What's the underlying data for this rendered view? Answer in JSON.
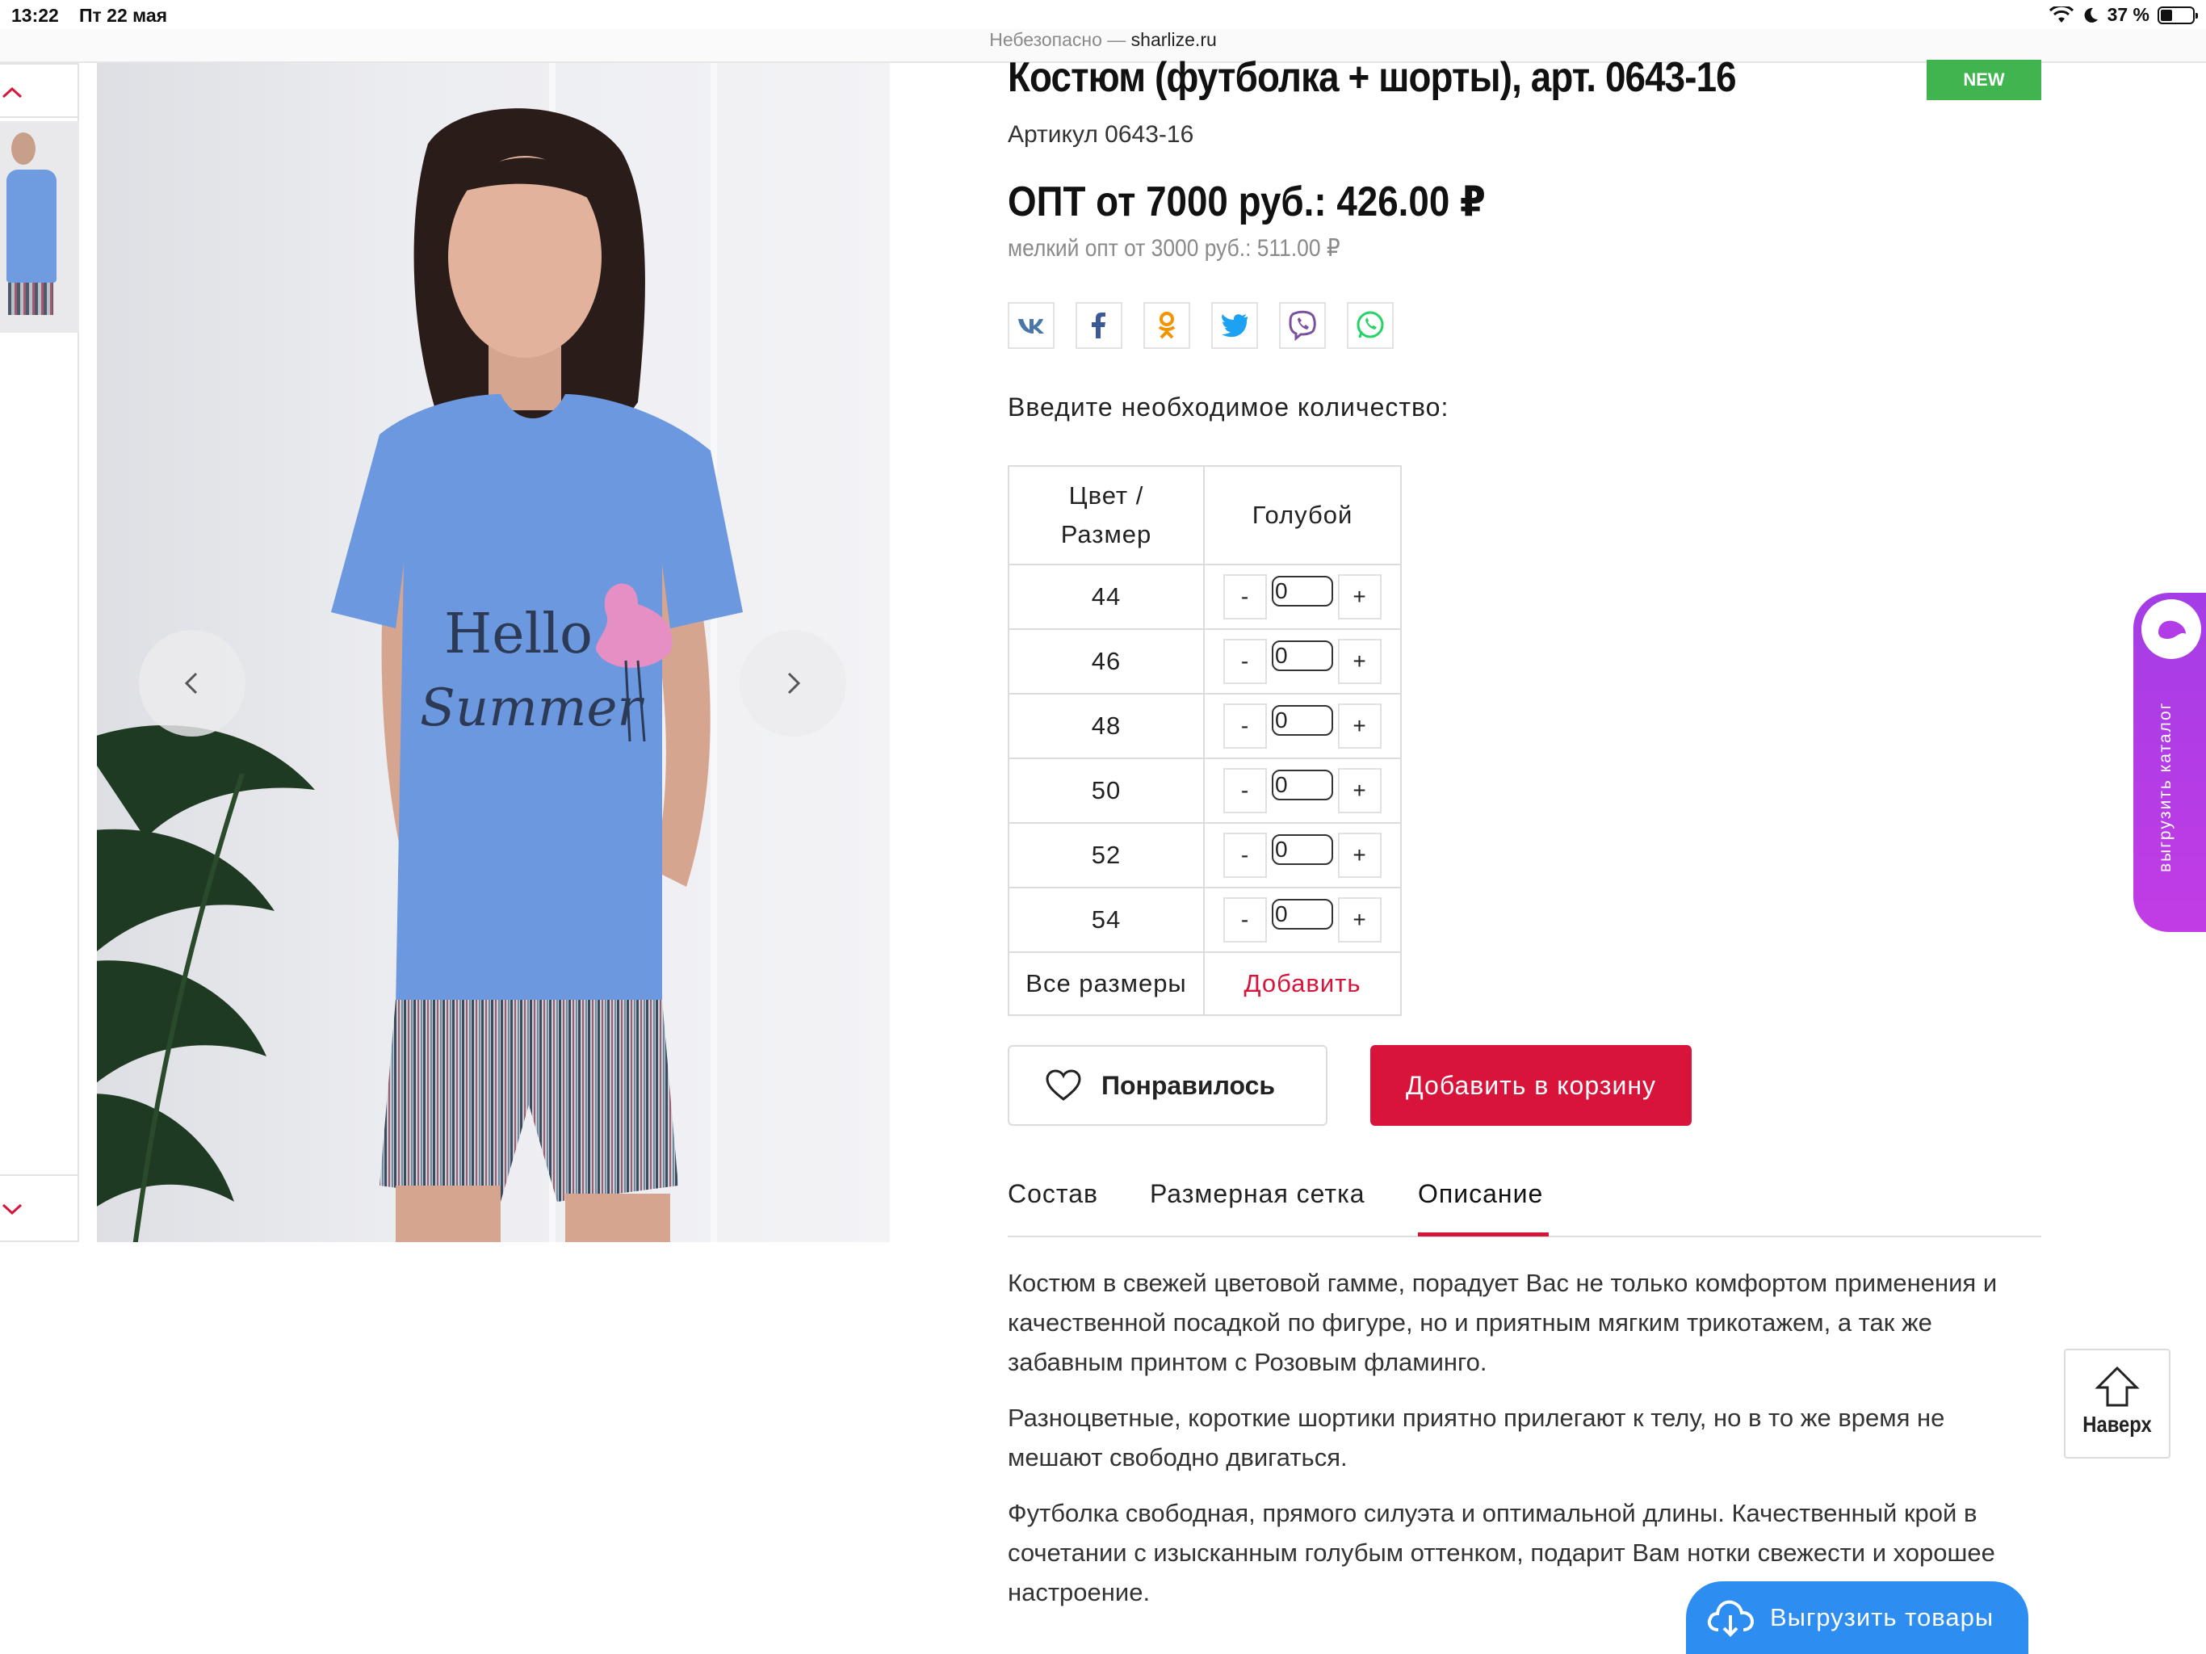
{
  "status_bar": {
    "time": "13:22",
    "date": "Пт 22 мая",
    "battery": "37 %",
    "battery_level": 0.37
  },
  "address_bar": {
    "security": "Небезопасно — ",
    "host": "sharlize.ru"
  },
  "gallery": {
    "thumb_count": 1
  },
  "product": {
    "title": "Костюм (футболка + шорты), арт. 0643-16",
    "badge": "NEW",
    "sku": "Артикул 0643-16",
    "price_main": "ОПТ от 7000 руб.: 426.00 ₽",
    "price_small": "мелкий опт от 3000 руб.: 511.00 ₽",
    "print_text_line1": "Hello",
    "print_text_line2": "Summer"
  },
  "share_icons": [
    "vk-icon",
    "facebook-icon",
    "odnoklassniki-icon",
    "twitter-icon",
    "viber-icon",
    "whatsapp-icon"
  ],
  "quantity": {
    "prompt": "Введите необходимое количество:",
    "header_col1": "Цвет / Размер",
    "header_col2": "Голубой",
    "minus": "-",
    "plus": "+",
    "rows": [
      {
        "size": "44",
        "value": "0"
      },
      {
        "size": "46",
        "value": "0"
      },
      {
        "size": "48",
        "value": "0"
      },
      {
        "size": "50",
        "value": "0"
      },
      {
        "size": "52",
        "value": "0"
      },
      {
        "size": "54",
        "value": "0"
      }
    ],
    "all_sizes_label": "Все размеры",
    "add_label": "Добавить"
  },
  "actions": {
    "like": "Понравилось",
    "add_to_cart": "Добавить в корзину"
  },
  "tabs": [
    {
      "label": "Состав",
      "active": false
    },
    {
      "label": "Размерная сетка",
      "active": false
    },
    {
      "label": "Описание",
      "active": true
    }
  ],
  "description": [
    "Костюм в свежей цветовой гамме, порадует Вас не только комфортом применения и качественной посадкой по фигуре, но и приятным мягким трикотажем, а так же забавным принтом с Розовым фламинго.",
    "Разноцветные, короткие шортики приятно прилегают к телу, но в то же время не мешают свободно двигаться.",
    "Футболка свободная, прямого силуэта и оптимальной длины. Качественный крой в сочетании с изысканным голубым оттенком, подарит Вам нотки свежести и хорошее настроение."
  ],
  "widgets": {
    "catalog_export": "выгрузить каталог",
    "to_top": "Наверх",
    "export_goods": "Выгрузить товары"
  },
  "colors": {
    "accent": "#d8143b",
    "badge": "#3fb44f",
    "catalog": "#b23de6",
    "export": "#2d8df0"
  }
}
